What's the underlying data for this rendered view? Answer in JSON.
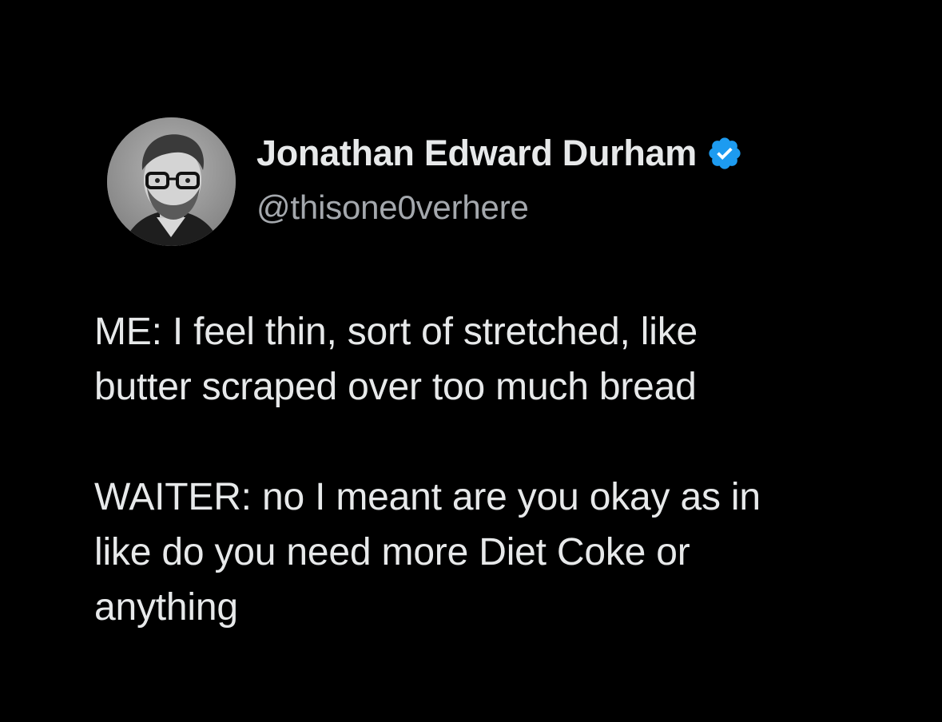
{
  "author": {
    "display_name": "Jonathan Edward Durham",
    "handle": "@thisone0verhere",
    "verified": true,
    "avatar_icon": "profile-photo-avatar",
    "verified_icon": "verified-badge-icon",
    "verified_color": "#1d9bf0"
  },
  "tweet": {
    "paragraphs": [
      "ME: I feel thin, sort of stretched, like\nbutter scraped over too much bread",
      "WAITER: no I meant are you okay as in\nlike do you need more Diet Coke or\nanything"
    ]
  },
  "colors": {
    "background": "#000000",
    "primary_text": "#e7e9ea",
    "secondary_text": "#a4a8ad"
  }
}
